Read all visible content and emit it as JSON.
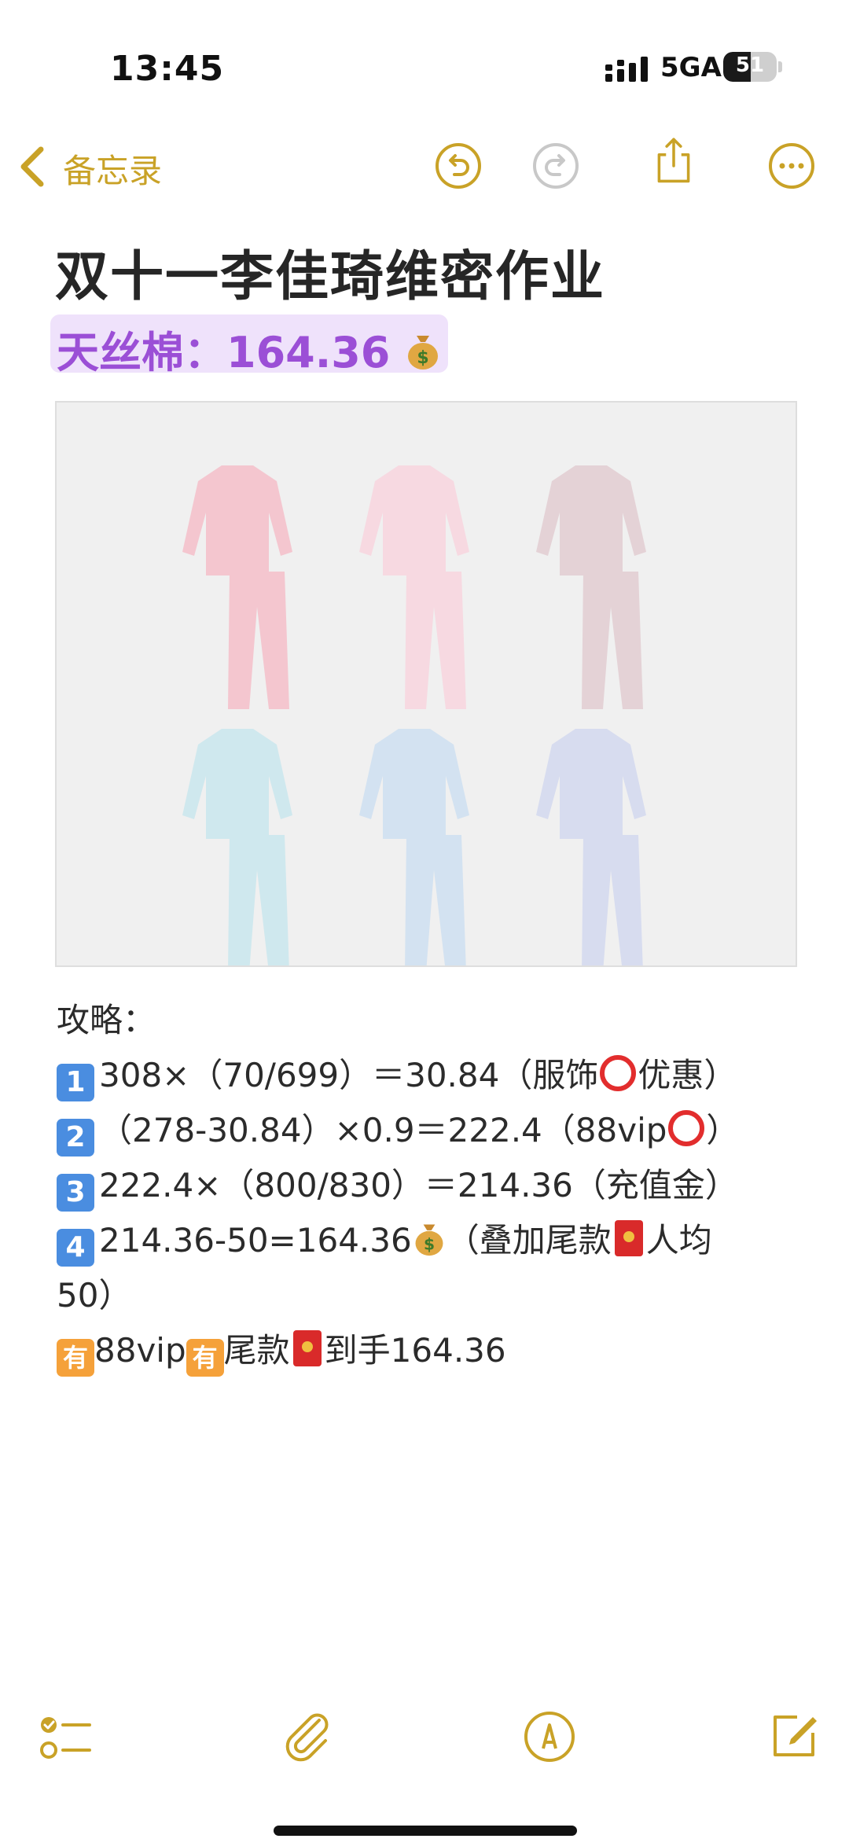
{
  "status_bar": {
    "time": "13:45",
    "network": "5GA",
    "battery": "51"
  },
  "nav": {
    "back_label": "备忘录",
    "icons": [
      "chevron-left-icon",
      "undo-icon",
      "redo-icon",
      "share-icon",
      "more-icon"
    ]
  },
  "note": {
    "title": "双十一李佳琦维密作业",
    "highlight": "天丝棉：164.36",
    "image_label": "product photo of six pajama sets",
    "strategy_heading": "攻略：",
    "lines": {
      "l1_num": "1",
      "l1_a": "308×（70/699）＝30.84（服饰",
      "l1_b": "优惠）",
      "l2_num": "2",
      "l2_a": "（278-30.84）×0.9＝222.4（88vip",
      "l2_b": "）",
      "l3_num": "3",
      "l3_a": "222.4×（800/830）＝214.36（充值金）",
      "l4_num": "4",
      "l4_a": "214.36-50=164.36",
      "l4_b": "（叠加尾款",
      "l4_c": "人均",
      "l4_d": "50）",
      "l5_have1": "有",
      "l5_a": "88vip",
      "l5_have2": "有",
      "l5_b": "尾款",
      "l5_c": "到手164.36"
    }
  },
  "colors": {
    "accent": "#c9a227",
    "highlight_bg": "#efe2fb",
    "highlight_text": "#9b4fd6",
    "num_icon": "#4a8de0",
    "have_icon": "#f5a13a",
    "ring_red": "#e22d2d",
    "envelope_red": "#d92a2a"
  },
  "toolbar": {
    "icons": [
      "checklist-icon",
      "attachment-icon",
      "markup-icon",
      "compose-icon"
    ]
  }
}
